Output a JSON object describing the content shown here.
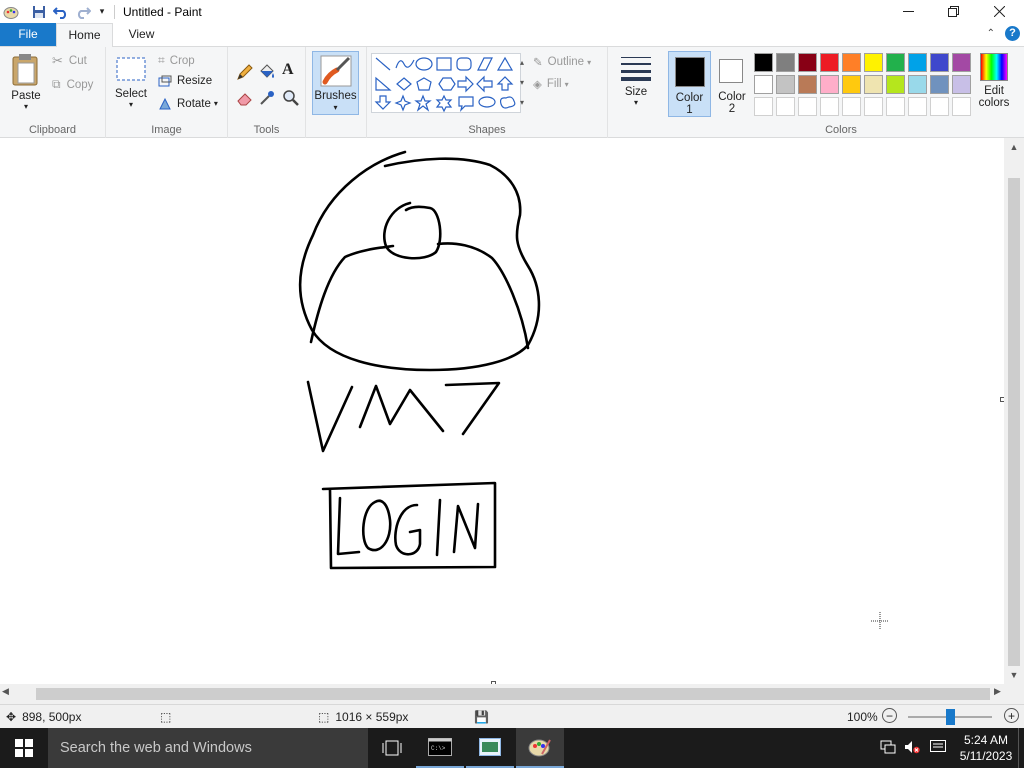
{
  "window": {
    "title": "Untitled - Paint"
  },
  "tabs": [
    {
      "label": "File"
    },
    {
      "label": "Home"
    },
    {
      "label": "View"
    }
  ],
  "clipboard": {
    "paste": "Paste",
    "cut": "Cut",
    "copy": "Copy",
    "label": "Clipboard"
  },
  "image": {
    "select": "Select",
    "crop": "Crop",
    "resize": "Resize",
    "rotate": "Rotate",
    "label": "Image"
  },
  "tools": {
    "label": "Tools"
  },
  "brushes": {
    "label": "Brushes"
  },
  "shapes": {
    "outline": "Outline",
    "fill": "Fill",
    "label": "Shapes"
  },
  "size": {
    "label": "Size"
  },
  "color1": {
    "line1": "Color",
    "line2": "1"
  },
  "color2": {
    "line1": "Color",
    "line2": "2"
  },
  "colors": {
    "label": "Colors",
    "edit_line1": "Edit",
    "edit_line2": "colors",
    "row1": [
      "#000000",
      "#7f7f7f",
      "#880015",
      "#ed1c24",
      "#ff7f27",
      "#fff200",
      "#22b14c",
      "#00a2e8",
      "#3f48cc",
      "#a349a4"
    ],
    "row2": [
      "#ffffff",
      "#c3c3c3",
      "#b97a57",
      "#ffaec9",
      "#ffc90e",
      "#efe4b0",
      "#b5e61d",
      "#99d9ea",
      "#7092be",
      "#c8bfe7"
    ],
    "row3": [
      "#ffffff",
      "#ffffff",
      "#ffffff",
      "#ffffff",
      "#ffffff",
      "#ffffff",
      "#ffffff",
      "#ffffff",
      "#ffffff",
      "#ffffff"
    ]
  },
  "status": {
    "cursor_pos": "898, 500px",
    "canvas_size": "1016 × 559px",
    "zoom": "100%"
  },
  "taskbar": {
    "search_placeholder": "Search the web and Windows",
    "time": "5:24 AM",
    "date": "5/11/2023"
  }
}
